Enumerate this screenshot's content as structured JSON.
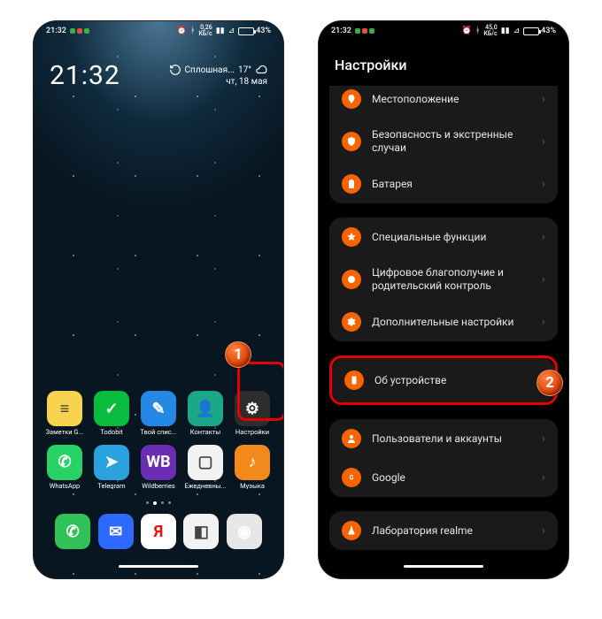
{
  "statusbar": {
    "time": "21:32",
    "speed_top": "0,26",
    "speed_unit": "КБ/с",
    "battery_pct": "43%",
    "battery_fill": 43
  },
  "home": {
    "clock": "21:32",
    "weather_cond": "Сплошная...",
    "weather_temp": "17°",
    "date": "чт, 18 мая",
    "badge": "1",
    "apps_row1": [
      {
        "label": "Заметки G...",
        "cls": "ic-yel",
        "glyph": "≡"
      },
      {
        "label": "Todobit",
        "cls": "ic-grn",
        "glyph": "✓"
      },
      {
        "label": "Твой спис...",
        "cls": "ic-blu",
        "glyph": "✎"
      },
      {
        "label": "Контакты",
        "cls": "ic-teal",
        "glyph": "👤"
      },
      {
        "label": "Настройки",
        "cls": "ic-gray",
        "glyph": "⚙"
      }
    ],
    "apps_row2": [
      {
        "label": "WhatsApp",
        "cls": "ic-wa",
        "glyph": "✆"
      },
      {
        "label": "Telegram",
        "cls": "ic-tg",
        "glyph": "➤"
      },
      {
        "label": "Wildberries",
        "cls": "ic-wb",
        "glyph": "WB"
      },
      {
        "label": "Ежедневны...",
        "cls": "ic-wh",
        "glyph": "▢"
      },
      {
        "label": "Музыка",
        "cls": "ic-org",
        "glyph": "♪"
      }
    ],
    "dock": [
      {
        "cls": "ic-ph",
        "glyph": "✆"
      },
      {
        "cls": "ic-sms",
        "glyph": "✉"
      },
      {
        "cls": "ic-y",
        "glyph": "Я"
      },
      {
        "cls": "ic-wh",
        "glyph": "◧"
      },
      {
        "cls": "ic-cam",
        "glyph": "◉"
      }
    ]
  },
  "settings": {
    "header": "Настройки",
    "badge": "2",
    "group1": [
      {
        "label": "Местоположение",
        "icon": "pin"
      },
      {
        "label": "Безопасность и экстренные случаи",
        "icon": "shield"
      },
      {
        "label": "Батарея",
        "icon": "battery"
      }
    ],
    "group2": [
      {
        "label": "Специальные функции",
        "icon": "star"
      },
      {
        "label": "Цифровое благополучие и родительский контроль",
        "icon": "circle"
      },
      {
        "label": "Дополнительные настройки",
        "icon": "gear"
      }
    ],
    "highlighted": {
      "label": "Об устройстве",
      "icon": "phone"
    },
    "group3": [
      {
        "label": "Пользователи и аккаунты",
        "icon": "user"
      },
      {
        "label": "Google",
        "icon": "g"
      }
    ],
    "group4": [
      {
        "label": "Лаборатория realme",
        "icon": "flask"
      }
    ]
  }
}
